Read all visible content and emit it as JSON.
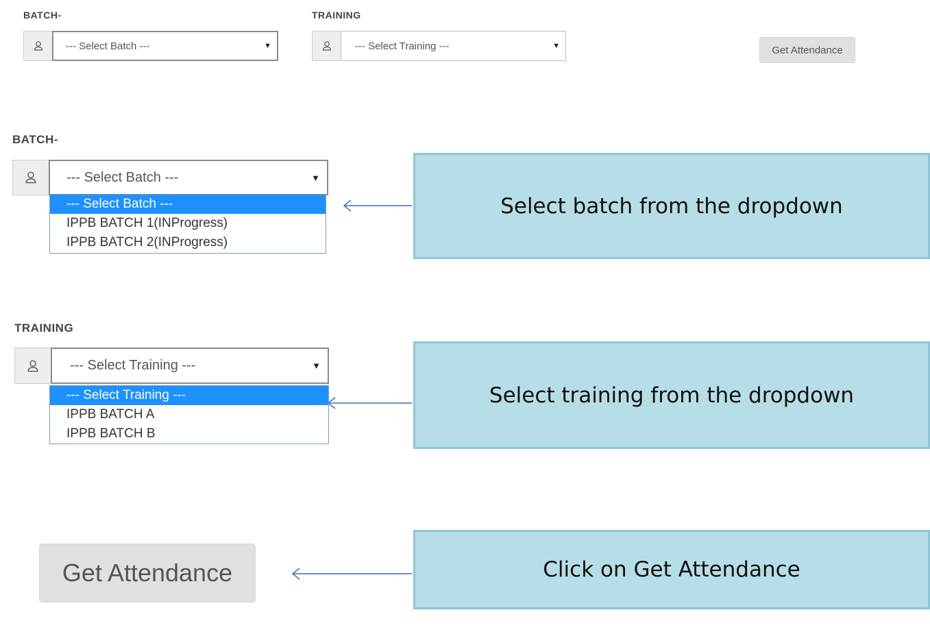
{
  "top_form": {
    "batch_label": "BATCH-",
    "batch_placeholder": "--- Select Batch ---",
    "training_label": "TRAINING",
    "training_placeholder": "--- Select Training ---",
    "get_attendance_label": "Get Attendance"
  },
  "step1": {
    "batch_label": "BATCH-",
    "select_value": "--- Select Batch ---",
    "options": [
      "--- Select Batch ---",
      "IPPB BATCH 1(INProgress)",
      "IPPB BATCH 2(INProgress)"
    ],
    "selected_index": 0,
    "callout": "Select batch from the dropdown"
  },
  "step2": {
    "training_label": "TRAINING",
    "select_value": "--- Select Training ---",
    "options": [
      "--- Select Training ---",
      "IPPB BATCH A",
      "IPPB BATCH B"
    ],
    "selected_index": 0,
    "callout": "Select training from the dropdown"
  },
  "step3": {
    "button_label": "Get Attendance",
    "callout": "Click on Get Attendance"
  },
  "icons": {
    "select_prefix": "user-icon",
    "dropdown": "caret-down-icon"
  },
  "colors": {
    "callout_fill": "#b7dde8",
    "callout_border": "#8ec6d8",
    "selected_option": "#1e90ff",
    "arrow": "#3a6fb0"
  }
}
